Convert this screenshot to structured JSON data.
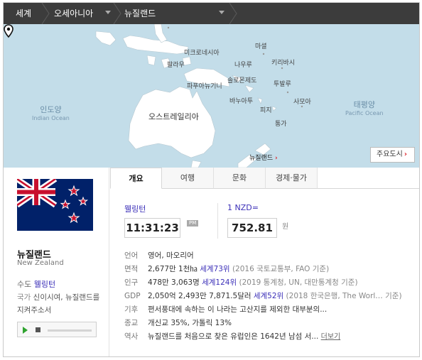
{
  "breadcrumb": {
    "world": "세계",
    "region": "오세아니아",
    "country": "뉴질랜드"
  },
  "map": {
    "labels": {
      "micronesia": "미크로네시아",
      "marshall": "마셜",
      "nauru": "나우루",
      "kiribati": "키리바시",
      "palau": "팔라우",
      "solomon": "솔로몬제도",
      "tuvalu": "투발루",
      "png": "파푸아뉴기니",
      "vanuatu": "바누아투",
      "samoa": "사모아",
      "fiji": "피지",
      "tonga": "통가",
      "australia": "오스트레일리아"
    },
    "oceans": {
      "indian_ko": "인도양",
      "indian_en": "Indian Ocean",
      "pacific_ko": "태평양",
      "pacific_en": "Pacific Ocean"
    },
    "pin_label": "뉴질랜드",
    "pin_arrow": "›",
    "cities_button": "주요도시",
    "cities_arrow": "›"
  },
  "profile": {
    "name_ko": "뉴질랜드",
    "name_en": "New Zealand",
    "capital_label": "수도",
    "capital": "웰링턴",
    "anthem_label": "국가",
    "anthem": "신이시여, 뉴질랜드를 지켜주소서"
  },
  "tabs": [
    "개요",
    "여행",
    "문화",
    "경제·물가"
  ],
  "clock": {
    "city": "웰링턴",
    "time": "11:31:23",
    "ampm": "PM"
  },
  "currency": {
    "label": "1 NZD=",
    "value": "752.81",
    "unit": "원"
  },
  "facts": {
    "language": {
      "label": "언어",
      "value": "영어, 마오리어"
    },
    "area": {
      "label": "면적",
      "value": "2,677만 1천㏊",
      "rank": "세계73위",
      "source": "(2016 국토교통부, FAO 기준)"
    },
    "population": {
      "label": "인구",
      "value": "478만 3,063명",
      "rank": "세계124위",
      "source": "(2019 통계청, UN, 대만통계청 기준)"
    },
    "gdp": {
      "label": "GDP",
      "value": "2,050억 2,493만 7,871.5달러",
      "rank": "세계52위",
      "source": "(2018 한국은행, The Worl…   기준)"
    },
    "climate": {
      "label": "기후",
      "value": "편서풍대에 속하는 이 나라는 고산지를 제외한 대부분의..."
    },
    "religion": {
      "label": "종교",
      "value": "개신교 35%, 가톨릭 13%"
    },
    "history": {
      "label": "역사",
      "value": "뉴질랜드를 처음으로 찾은 유럽인은 1642년 남섬 서...",
      "more": "더보기"
    }
  }
}
